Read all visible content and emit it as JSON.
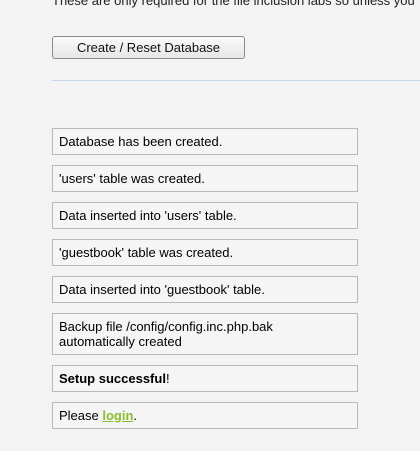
{
  "header": {
    "text": "These are only required for the file inclusion labs so unless you"
  },
  "actions": {
    "reset_button_label": "Create / Reset Database"
  },
  "messages": [
    "Database has been created.",
    "'users' table was created.",
    "Data inserted into 'users' table.",
    "'guestbook' table was created.",
    "Data inserted into 'guestbook' table.",
    "Backup file /config/config.inc.php.bak automatically created"
  ],
  "setup": {
    "success_strong": "Setup successful",
    "success_suffix": "!"
  },
  "login_prompt": {
    "prefix": "Please ",
    "link": "login",
    "suffix": "."
  },
  "colors": {
    "background": "#f3f3f3",
    "message_border": "#b9b9b9",
    "link": "#8cbc2f",
    "divider": "#c6d6e8"
  }
}
